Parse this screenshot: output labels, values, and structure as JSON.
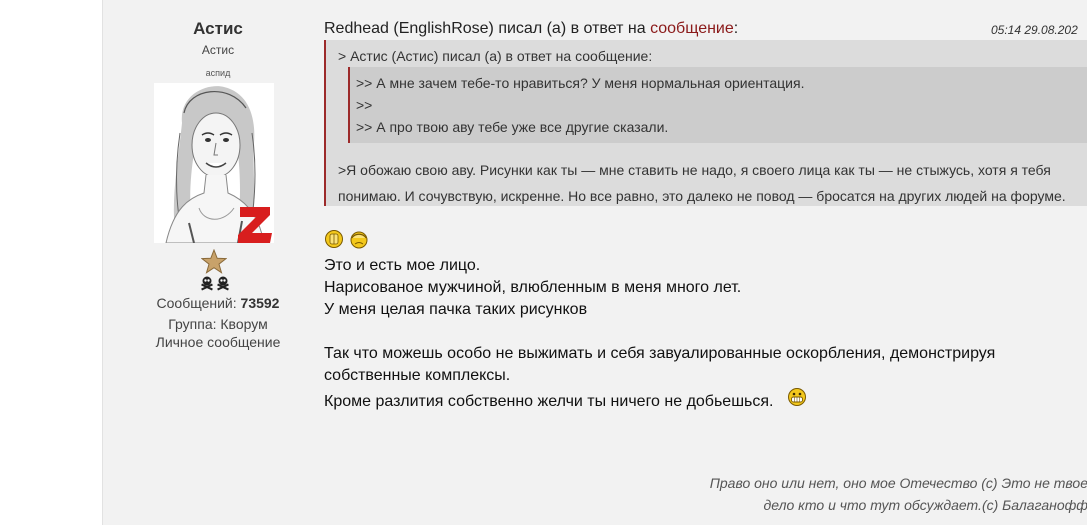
{
  "author": {
    "name": "Астис",
    "title": "Астис",
    "rank": "аспид",
    "messages_label": "Сообщений:",
    "messages_count": "73592",
    "group": "Группа: Кворум",
    "pm_link": "Личное сообщение"
  },
  "post": {
    "header_prefix": "Redhead (EnglishRose) писал (а) в ответ на ",
    "header_link": "сообщение",
    "header_suffix": ":",
    "date": "05:14 29.08.202",
    "quote": {
      "outer_head": "> Астис (Астис) писал (а) в ответ на сообщение:",
      "inner_lines": [
        ">> А мне зачем тебе-то нравиться? У меня нормальная ориентация.",
        ">>",
        ">> А про твою аву тебе уже все другие сказали."
      ],
      "reply_lines": [
        ">Я обожаю свою аву. Рисунки как ты — мне ставить не надо, я своего лица как ты — не стыжусь, хотя я тебя",
        "понимаю. И сочувствую, искренне. Но все равно, это далеко не повод — бросатся на других людей на форуме."
      ]
    },
    "body_lines": [
      "Это и есть мое лицо.",
      "Нарисованое мужчиной, влюбленным в меня много лет.",
      "У меня целая пачка таких рисунков",
      "Так что можешь особо не выжимать и себя завуалированные оскорбления, демонстрируя",
      "собственные комплексы.",
      "Кроме разлития собственно желчи ты ничего не добьешься."
    ],
    "signature_lines": [
      "Право оно или нет, оно мое Отечество (с) Это не твое",
      "дело кто и что тут обсуждает.(с) Балаганофф"
    ]
  },
  "colors": {
    "quote_border": "#9c2a2a",
    "link": "#8b1a1a",
    "post_bg": "#f2f2f2"
  }
}
